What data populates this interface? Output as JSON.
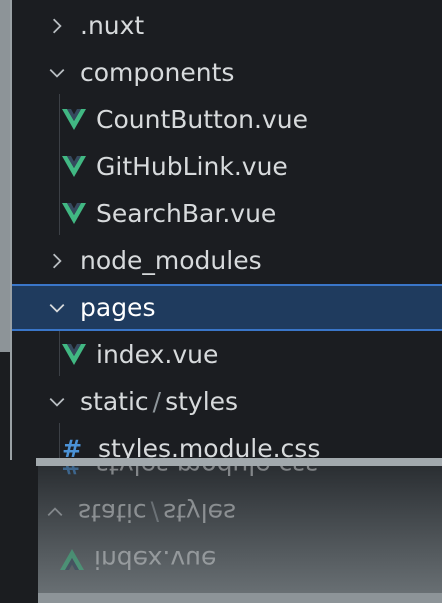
{
  "explorer": {
    "items": [
      {
        "label": ".nuxt",
        "type": "folder",
        "state": "collapsed",
        "depth": 0
      },
      {
        "label": "components",
        "type": "folder",
        "state": "expanded",
        "depth": 0
      },
      {
        "label": "CountButton.vue",
        "type": "vue-file",
        "depth": 1
      },
      {
        "label": "GitHubLink.vue",
        "type": "vue-file",
        "depth": 1
      },
      {
        "label": "SearchBar.vue",
        "type": "vue-file",
        "depth": 1
      },
      {
        "label": "node_modules",
        "type": "folder",
        "state": "collapsed",
        "depth": 0
      },
      {
        "label": "pages",
        "type": "folder",
        "state": "expanded",
        "depth": 0,
        "selected": true
      },
      {
        "label": "index.vue",
        "type": "vue-file",
        "depth": 1
      },
      {
        "label_a": "static",
        "separator": "/",
        "label_b": "styles",
        "type": "folder",
        "state": "expanded",
        "depth": 0
      },
      {
        "label": "styles.module.css",
        "type": "css-file",
        "depth": 1
      }
    ]
  },
  "reflection": {
    "items": [
      {
        "label": "styles.module.css"
      },
      {
        "label_a": "static",
        "separator": "/",
        "label_b": "styles"
      },
      {
        "label": "index.vue"
      }
    ]
  },
  "colors": {
    "vue_green": "#41b883",
    "vue_dark": "#35495e",
    "selection": "#1f3b5e",
    "selection_border": "#3a76c9",
    "css_hash": "#4b92d6"
  }
}
